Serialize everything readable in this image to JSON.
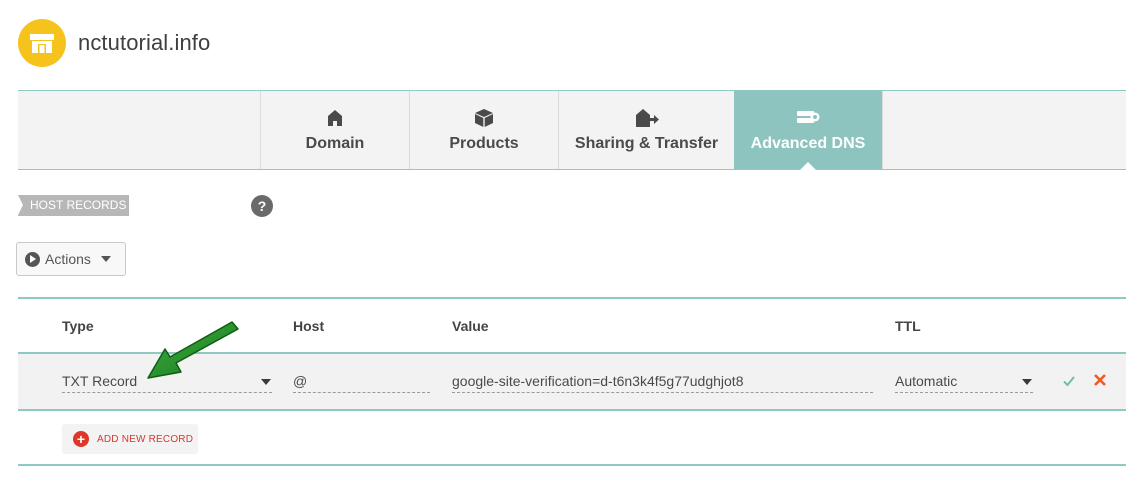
{
  "header": {
    "domain_name": "nctutorial.info",
    "logo_icon": "storefront-icon",
    "logo_color": "#f6c21c"
  },
  "tabs": [
    {
      "label": "Domain",
      "icon": "house-icon",
      "active": false
    },
    {
      "label": "Products",
      "icon": "box-icon",
      "active": false
    },
    {
      "label": "Sharing & Transfer",
      "icon": "house-transfer-icon",
      "active": false
    },
    {
      "label": "Advanced DNS",
      "icon": "server-icon",
      "active": true
    }
  ],
  "section": {
    "badge": "HOST RECORDS",
    "help_label": "?"
  },
  "actions": {
    "label": "Actions"
  },
  "table": {
    "columns": [
      "Type",
      "Host",
      "Value",
      "TTL"
    ],
    "rows": [
      {
        "type": "TXT Record",
        "host": "@",
        "value": "google-site-verification=d-t6n3k4f5g77udghjot8",
        "ttl": "Automatic"
      }
    ],
    "add_button": "ADD NEW RECORD"
  },
  "colors": {
    "accent_teal": "#8ec4bf",
    "confirm_green": "#6fbfa6",
    "cancel_orange": "#f15a24",
    "add_red": "#e0352b",
    "annotation_arrow": "#1f8a20"
  }
}
